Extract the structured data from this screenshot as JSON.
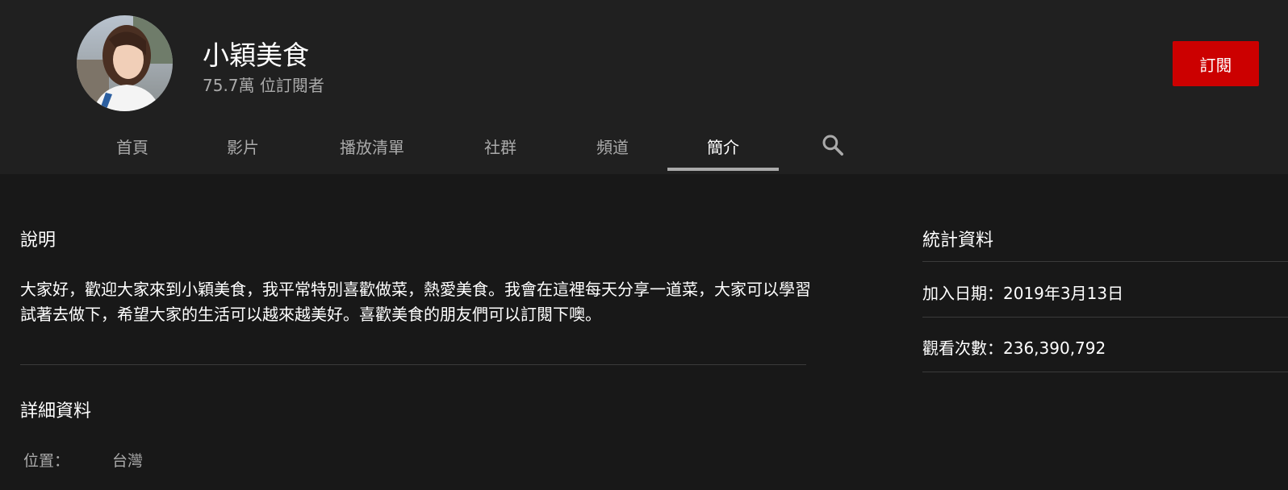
{
  "channel": {
    "name": "小穎美食",
    "subscribers": "75.7萬 位訂閱者",
    "subscribe_label": "訂閱"
  },
  "tabs": [
    {
      "label": "首頁",
      "active": false
    },
    {
      "label": "影片",
      "active": false
    },
    {
      "label": "播放清單",
      "active": false
    },
    {
      "label": "社群",
      "active": false
    },
    {
      "label": "頻道",
      "active": false
    },
    {
      "label": "簡介",
      "active": true
    }
  ],
  "search_icon": "search-icon",
  "about": {
    "description_title": "說明",
    "description": "大家好，歡迎大家來到小穎美食，我平常特別喜歡做菜，熱愛美食。我會在這裡每天分享一道菜，大家可以學習試著去做下，希望大家的生活可以越來越美好。喜歡美食的朋友們可以訂閱下噢。",
    "details_title": "詳細資料",
    "location_label": "位置：",
    "location_value": "台灣"
  },
  "stats": {
    "title": "統計資料",
    "joined": "加入日期：2019年3月13日",
    "views": "觀看次數：236,390,792"
  },
  "colors": {
    "header_bg": "#202020",
    "page_bg": "#181818",
    "subscribe_red": "#cc0000",
    "secondary_text": "#aaaaaa"
  }
}
